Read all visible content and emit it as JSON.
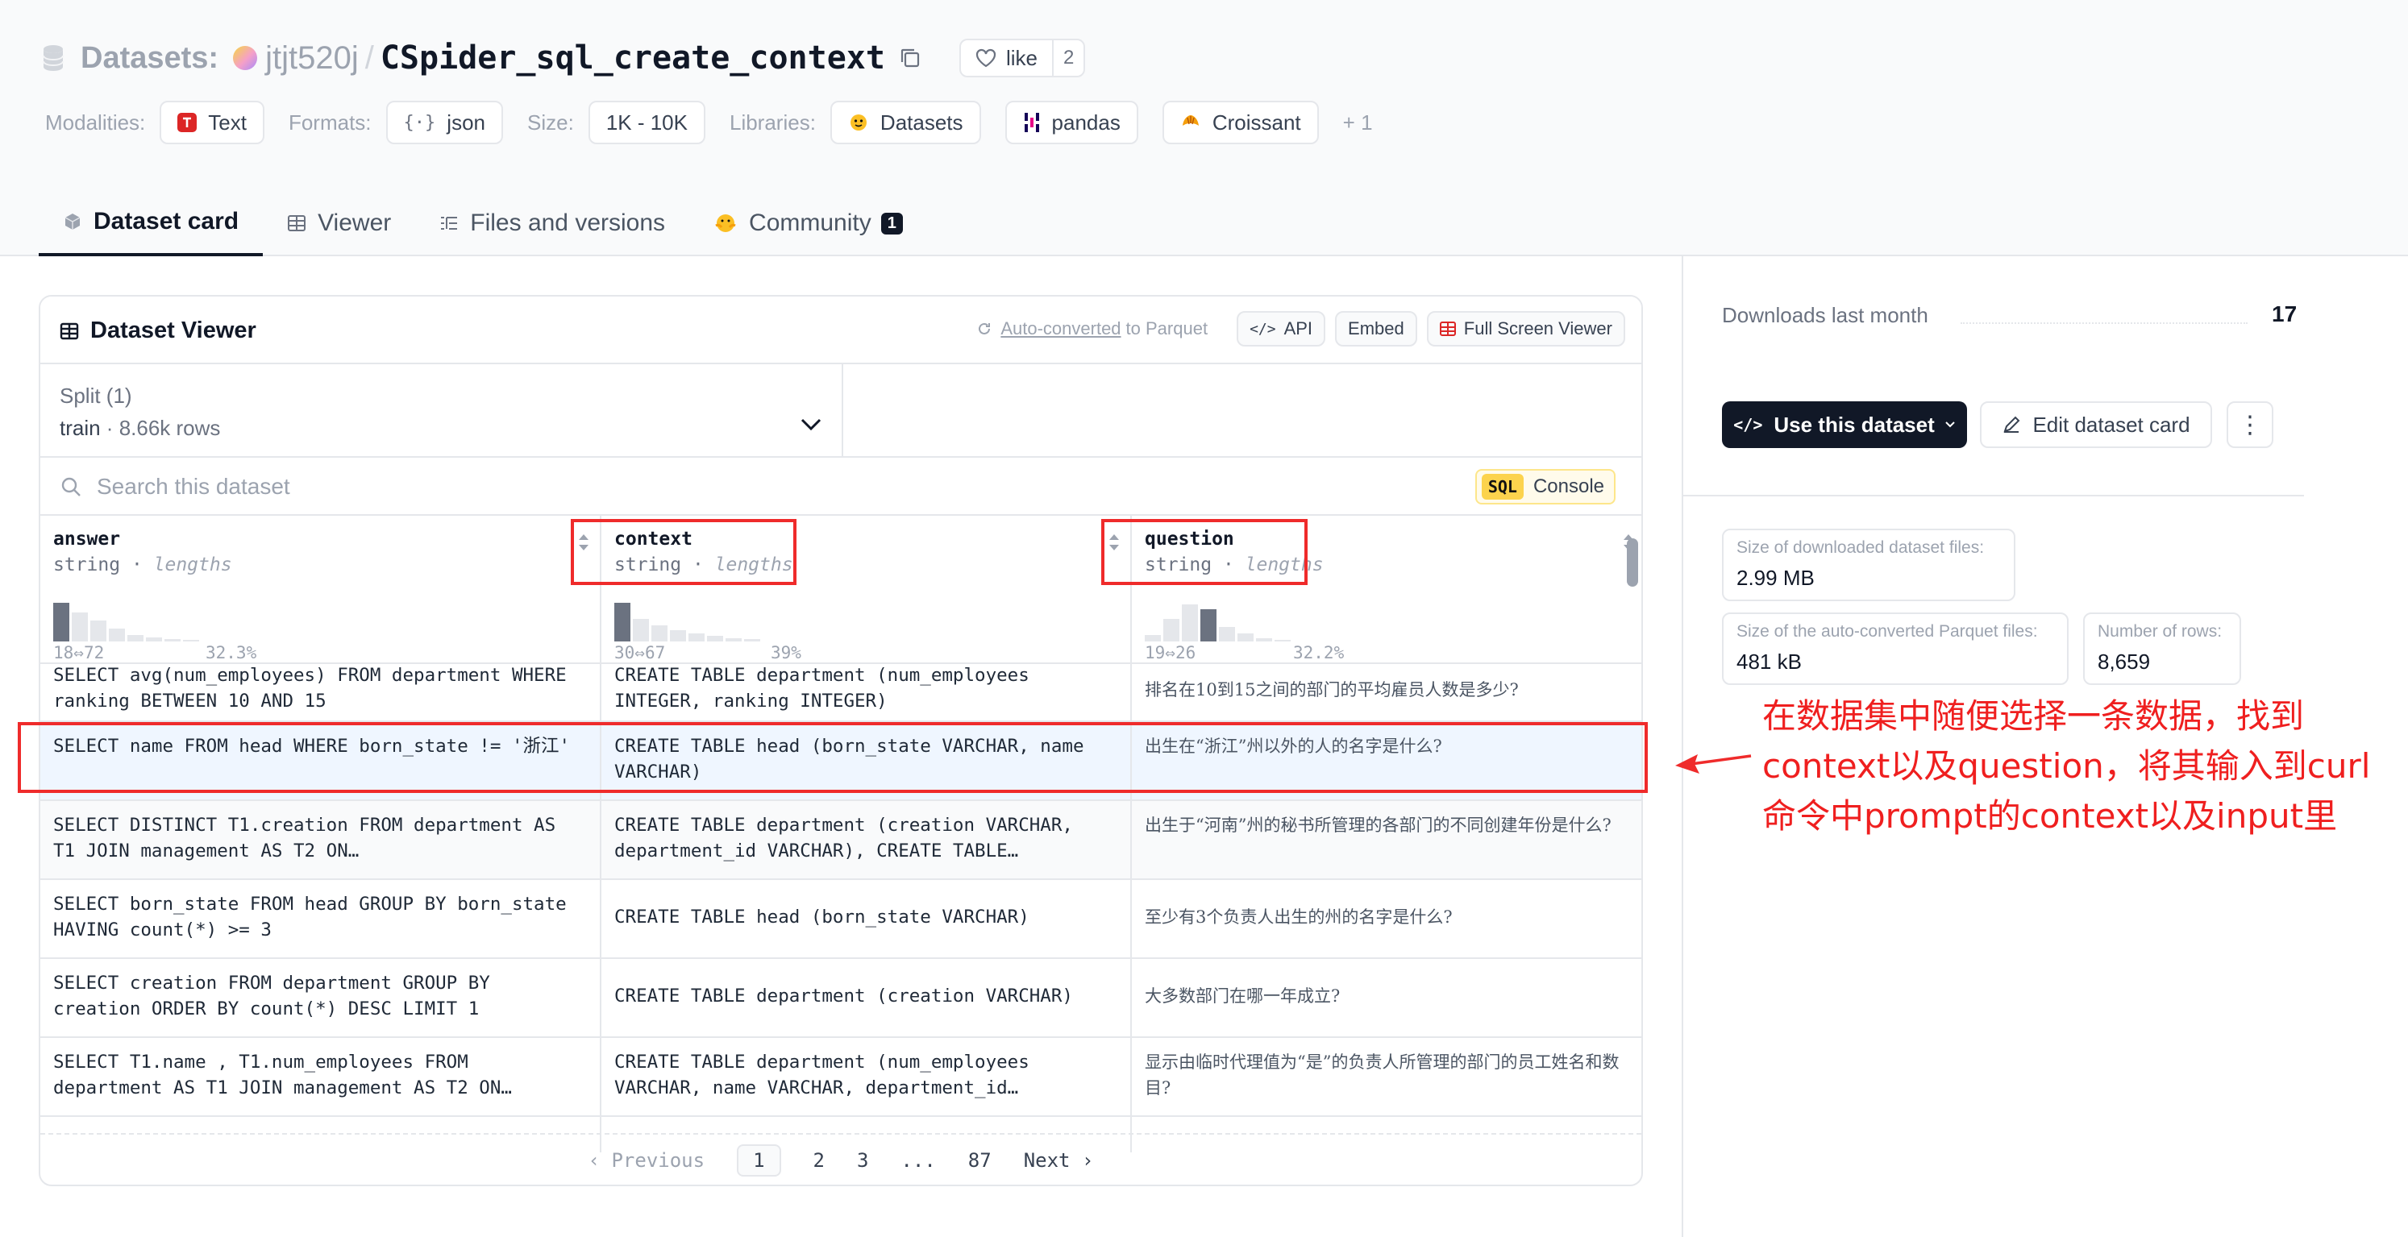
{
  "header": {
    "crumb_label": "Datasets:",
    "owner": "jtjt520j",
    "separator": "/",
    "repo": "CSpider_sql_create_context",
    "like_label": "like",
    "like_count": "2"
  },
  "meta": {
    "modalities_label": "Modalities:",
    "modality": "Text",
    "formats_label": "Formats:",
    "format": "json",
    "size_label": "Size:",
    "size": "1K - 10K",
    "libraries_label": "Libraries:",
    "libraries": [
      "Datasets",
      "pandas",
      "Croissant"
    ],
    "more": "+ 1"
  },
  "tabs": [
    {
      "label": "Dataset card",
      "icon": "cube-icon"
    },
    {
      "label": "Viewer",
      "icon": "table-icon"
    },
    {
      "label": "Files and versions",
      "icon": "files-icon"
    },
    {
      "label": "Community",
      "icon": "hug-icon",
      "badge": "1"
    }
  ],
  "viewer": {
    "title": "Dataset Viewer",
    "autoconv_link": "Auto-converted",
    "autoconv_suffix": "to Parquet",
    "api_label": "API",
    "embed_label": "Embed",
    "fullscreen_label": "Full Screen Viewer",
    "split_label": "Split (1)",
    "split_name": "train",
    "split_dot": " · ",
    "split_rows": "8.66k rows",
    "search_placeholder": "Search this dataset",
    "sql_tag": "SQL",
    "sql_label": "Console",
    "columns": [
      {
        "name": "answer",
        "type": "string",
        "sep": " · ",
        "stat": "lengths",
        "range_min": "18",
        "range_max": "72",
        "arrow": "⇔",
        "pct": "32.3%"
      },
      {
        "name": "context",
        "type": "string",
        "sep": " · ",
        "stat": "lengths",
        "range_min": "30",
        "range_max": "67",
        "arrow": "⇔",
        "pct": "39%"
      },
      {
        "name": "question",
        "type": "string",
        "sep": " · ",
        "stat": "lengths",
        "range_min": "19",
        "range_max": "26",
        "arrow": "⇔",
        "pct": "32.2%"
      }
    ],
    "rows": [
      {
        "answer": "SELECT avg(num_employees) FROM department WHERE ranking BETWEEN 10 AND 15",
        "context": "CREATE TABLE department (num_employees INTEGER, ranking INTEGER)",
        "question": "排名在10到15之间的部门的平均雇员人数是多少?"
      },
      {
        "answer": "SELECT name FROM head WHERE born_state != '浙江'",
        "context": "CREATE TABLE head (born_state VARCHAR, name VARCHAR)",
        "question": "出生在“浙江”州以外的人的名字是什么?"
      },
      {
        "answer": "SELECT DISTINCT T1.creation FROM department AS T1 JOIN management AS T2 ON…",
        "context": "CREATE TABLE department (creation VARCHAR, department_id VARCHAR), CREATE TABLE…",
        "question": "出生于“河南”州的秘书所管理的各部门的不同创建年份是什么?"
      },
      {
        "answer": "SELECT born_state FROM head GROUP BY born_state HAVING count(*) >= 3",
        "context": "CREATE TABLE head (born_state VARCHAR)",
        "question": "至少有3个负责人出生的州的名字是什么?"
      },
      {
        "answer": "SELECT creation FROM department GROUP BY creation ORDER BY count(*) DESC LIMIT 1",
        "context": "CREATE TABLE department (creation VARCHAR)",
        "question": "大多数部门在哪一年成立?"
      },
      {
        "answer": "SELECT T1.name , T1.num_employees FROM department AS T1 JOIN management AS T2 ON…",
        "context": "CREATE TABLE department (num_employees VARCHAR, name VARCHAR, department_id…",
        "question": "显示由临时代理值为“是”的负责人所管理的部门的员工姓名和数目?"
      }
    ],
    "pagination": {
      "prev": "Previous",
      "pages": [
        "1",
        "2",
        "3",
        "...",
        "87"
      ],
      "next": "Next",
      "current": "1"
    }
  },
  "sidebar": {
    "downloads_label": "Downloads last month",
    "downloads_value": "17",
    "use_label": "Use this dataset",
    "edit_label": "Edit dataset card",
    "kebab": "⋮",
    "stats": [
      {
        "label": "Size of downloaded dataset files:",
        "value": "2.99 MB"
      },
      {
        "label": "Size of the auto-converted Parquet files:",
        "value": "481 kB"
      },
      {
        "label": "Number of rows:",
        "value": "8,659"
      }
    ]
  },
  "annotation": {
    "note": "在数据集中随便选择一条数据，找到context以及question，将其输入到curl命令中prompt的context以及input里",
    "color": "#ef2b2b"
  }
}
